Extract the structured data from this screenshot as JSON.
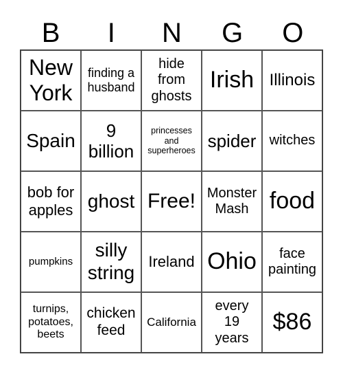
{
  "header": [
    "B",
    "I",
    "N",
    "G",
    "O"
  ],
  "cells": [
    "New York",
    "finding a husband",
    "hide from ghosts",
    "Irish",
    "Illinois",
    "Spain",
    "9 billion",
    "princesses and superheroes",
    "spider",
    "witches",
    "bob for apples",
    "ghost",
    "Free!",
    "Monster Mash",
    "food",
    "pumpkins",
    "silly string",
    "Ireland",
    "Ohio",
    "face painting",
    "turnips, potatoes, beets",
    "chicken feed",
    "California",
    "every 19 years",
    "$86"
  ]
}
